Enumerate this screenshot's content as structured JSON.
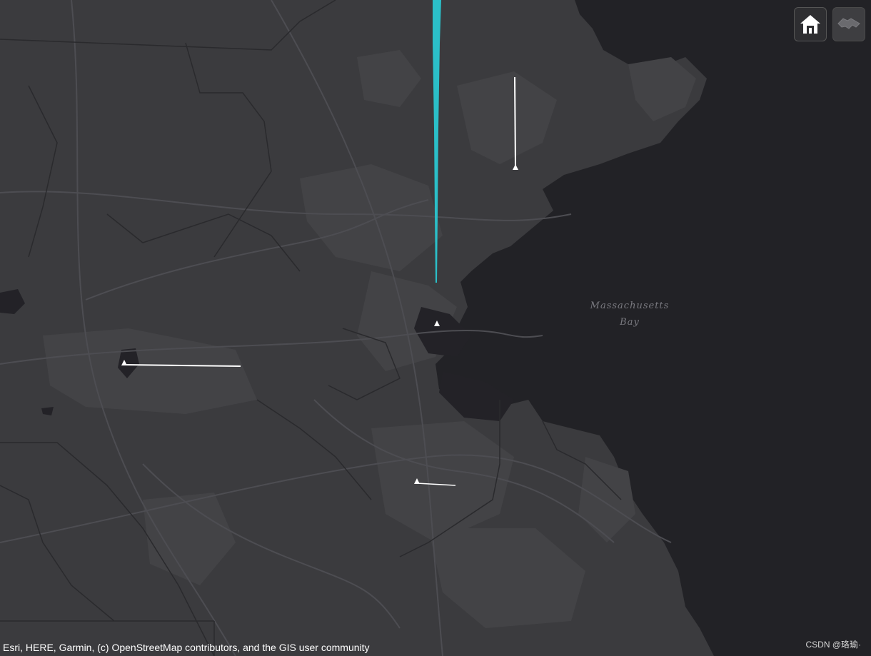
{
  "map": {
    "water_label": [
      "Massachusetts",
      "Bay"
    ],
    "attribution": "Esri, HERE, Garmin, (c) OpenStreetMap contributors, and the GIS user community",
    "watermark": "CSDN @珞瑜·",
    "basemap": "dark-gray-canvas",
    "colors": {
      "land": "#3b3b3e",
      "water": "#232227",
      "urban": "#434346",
      "roads": "#4d4d52",
      "boundaries": "#2a2a2d",
      "highlight_line": "#2bbfc8",
      "flow_lines": "#ffffff"
    }
  },
  "widgets": {
    "home_icon": "home-icon",
    "pan_icon": "handshake-icon"
  }
}
